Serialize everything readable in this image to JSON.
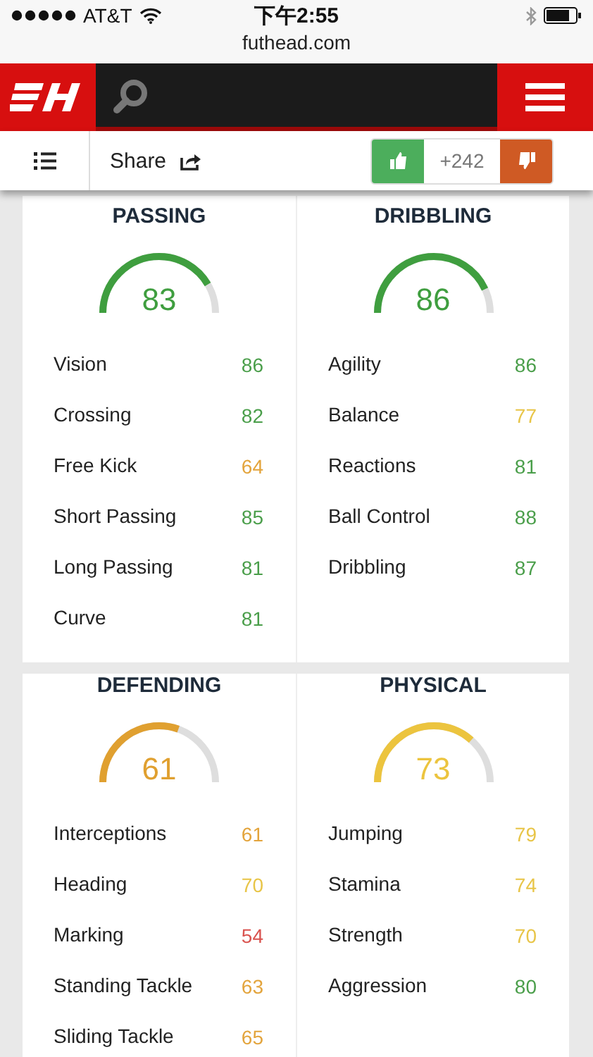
{
  "status_bar": {
    "carrier": "AT&T",
    "time": "下午2:55",
    "url": "futhead.com"
  },
  "toolbar": {
    "share": "Share",
    "votes": "+242"
  },
  "sections": [
    {
      "title": "PASSING",
      "rating": "83",
      "color": "#3f9e3f",
      "stats": [
        {
          "name": "Vision",
          "value": "86",
          "color": "#4a9e4a"
        },
        {
          "name": "Crossing",
          "value": "82",
          "color": "#4a9e4a"
        },
        {
          "name": "Free Kick",
          "value": "64",
          "color": "#e3a43c"
        },
        {
          "name": "Short Passing",
          "value": "85",
          "color": "#4a9e4a"
        },
        {
          "name": "Long Passing",
          "value": "81",
          "color": "#4a9e4a"
        },
        {
          "name": "Curve",
          "value": "81",
          "color": "#4a9e4a"
        }
      ]
    },
    {
      "title": "DRIBBLING",
      "rating": "86",
      "color": "#3f9e3f",
      "stats": [
        {
          "name": "Agility",
          "value": "86",
          "color": "#4a9e4a"
        },
        {
          "name": "Balance",
          "value": "77",
          "color": "#e8c548"
        },
        {
          "name": "Reactions",
          "value": "81",
          "color": "#4a9e4a"
        },
        {
          "name": "Ball Control",
          "value": "88",
          "color": "#4a9e4a"
        },
        {
          "name": "Dribbling",
          "value": "87",
          "color": "#4a9e4a"
        }
      ]
    },
    {
      "title": "DEFENDING",
      "rating": "61",
      "color": "#e0a030",
      "stats": [
        {
          "name": "Interceptions",
          "value": "61",
          "color": "#e3a43c"
        },
        {
          "name": "Heading",
          "value": "70",
          "color": "#e8c548"
        },
        {
          "name": "Marking",
          "value": "54",
          "color": "#d9534f"
        },
        {
          "name": "Standing Tackle",
          "value": "63",
          "color": "#e3a43c"
        },
        {
          "name": "Sliding Tackle",
          "value": "65",
          "color": "#e3a43c"
        }
      ]
    },
    {
      "title": "PHYSICAL",
      "rating": "73",
      "color": "#ecc43e",
      "stats": [
        {
          "name": "Jumping",
          "value": "79",
          "color": "#e8c548"
        },
        {
          "name": "Stamina",
          "value": "74",
          "color": "#e8c548"
        },
        {
          "name": "Strength",
          "value": "70",
          "color": "#e8c548"
        },
        {
          "name": "Aggression",
          "value": "80",
          "color": "#4a9e4a"
        }
      ]
    }
  ]
}
